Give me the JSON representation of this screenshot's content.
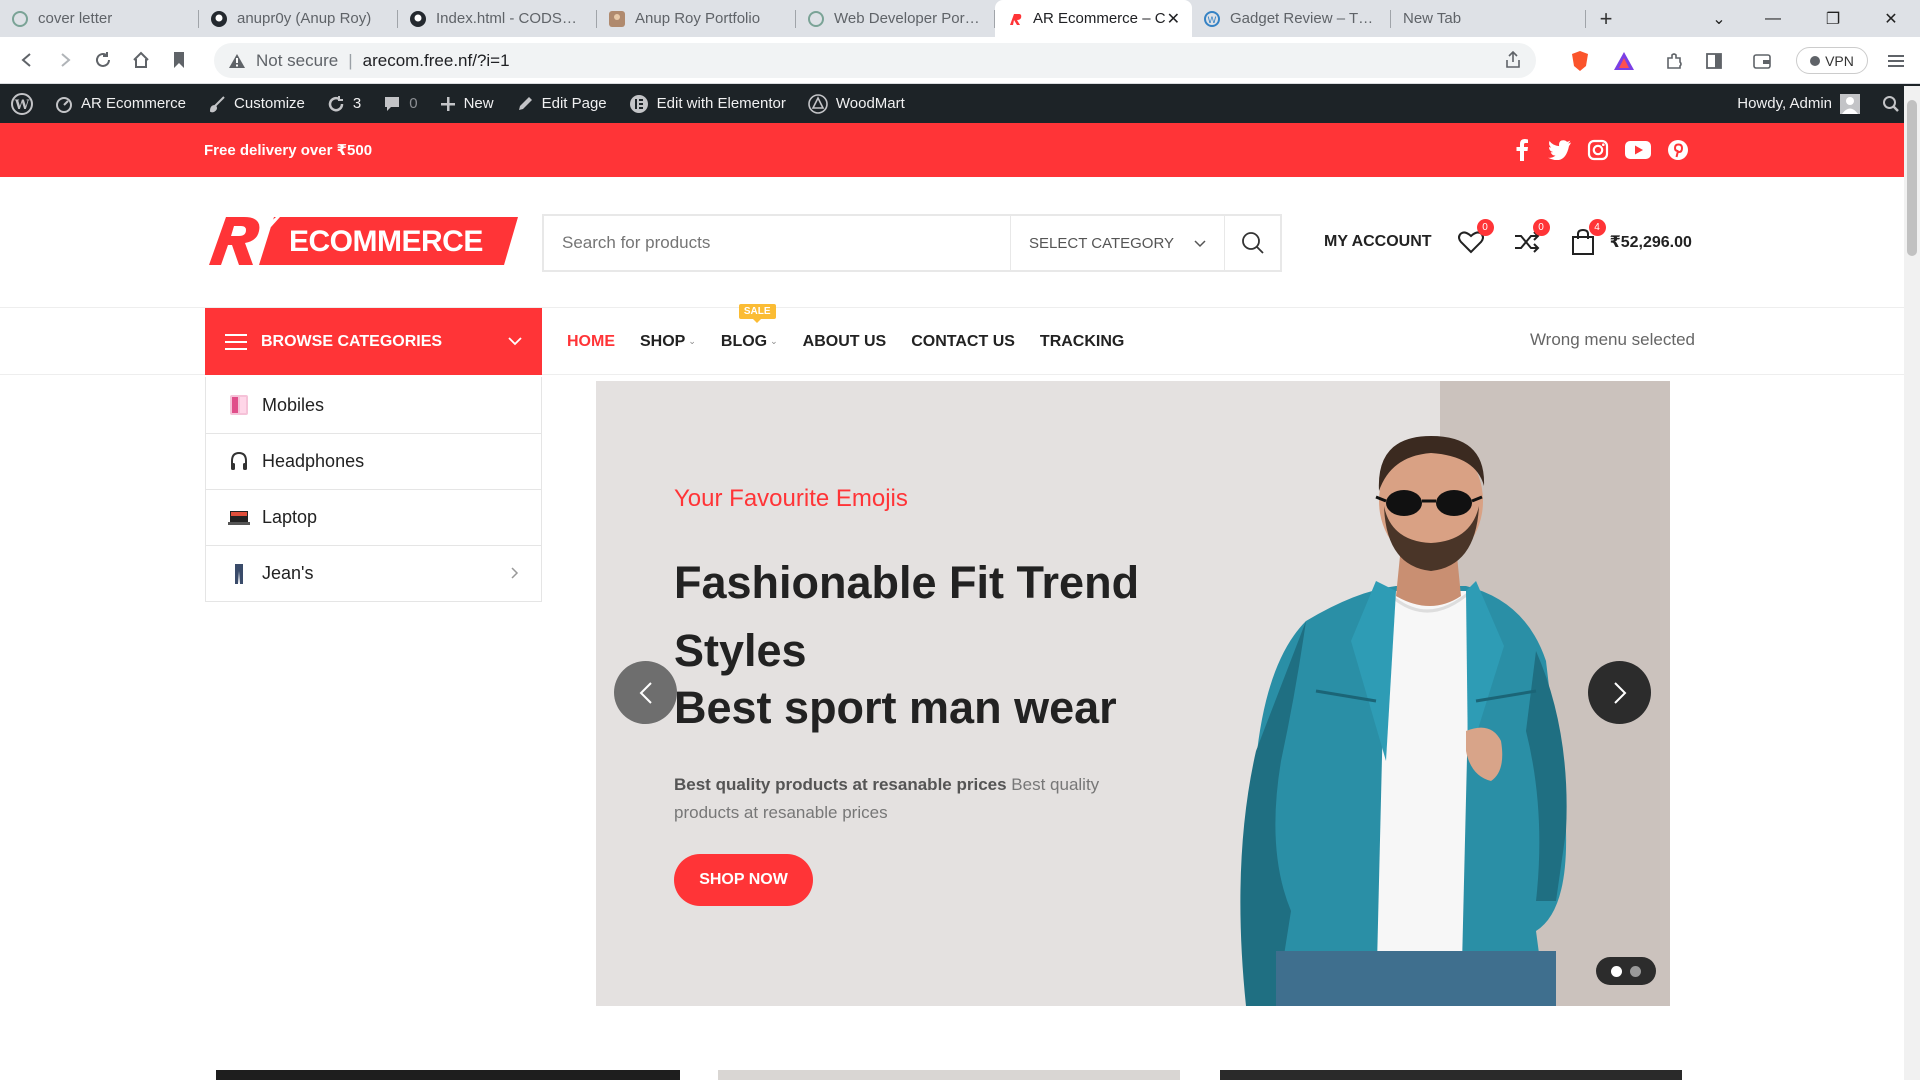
{
  "browser": {
    "tabs": [
      {
        "title": "cover letter"
      },
      {
        "title": "anupr0y (Anup Roy)"
      },
      {
        "title": "Index.html - CODSOFT"
      },
      {
        "title": "Anup Roy Portfolio"
      },
      {
        "title": "Web Developer Portfoli"
      },
      {
        "title": "AR Ecommerce – C",
        "active": true
      },
      {
        "title": "Gadget Review – The e"
      },
      {
        "title": "New Tab"
      }
    ],
    "address": {
      "security": "Not secure",
      "url": "arecom.free.nf/?i=1"
    },
    "vpn_label": "VPN"
  },
  "wp_admin_bar": {
    "site_name": "AR Ecommerce",
    "customize": "Customize",
    "updates_count": "3",
    "comments_count": "0",
    "new": "New",
    "edit_page": "Edit Page",
    "elementor": "Edit with Elementor",
    "woodmart": "WoodMart",
    "howdy": "Howdy, Admin"
  },
  "topbar": {
    "promo": "Free delivery over ₹500",
    "social": [
      "facebook-icon",
      "twitter-icon",
      "instagram-icon",
      "youtube-icon",
      "pinterest-icon"
    ]
  },
  "header": {
    "logo_text": "ECOMMERCE",
    "search_placeholder": "Search for products",
    "category_select": "SELECT CATEGORY",
    "my_account": "MY ACCOUNT",
    "wishlist_count": "0",
    "compare_count": "0",
    "cart_count": "4",
    "cart_total": "₹52,296.00"
  },
  "nav": {
    "browse": "BROWSE CATEGORIES",
    "links": [
      {
        "label": "HOME",
        "active": true
      },
      {
        "label": "SHOP"
      },
      {
        "label": "BLOG",
        "badge": "SALE"
      },
      {
        "label": "ABOUT US"
      },
      {
        "label": "CONTACT US"
      },
      {
        "label": "TRACKING"
      }
    ],
    "right_text": "Wrong menu selected"
  },
  "categories": [
    {
      "label": "Mobiles"
    },
    {
      "label": "Headphones"
    },
    {
      "label": "Laptop"
    },
    {
      "label": "Jean's"
    }
  ],
  "hero": {
    "kicker": "Your Favourite Emojis",
    "title_line1": "Fashionable Fit Trend Styles",
    "title_line2": "Best sport man wear",
    "desc_bold": "Best quality products at resanable prices",
    "desc_rest": "Best quality products at resanable prices",
    "cta": "SHOP NOW"
  },
  "colors": {
    "brand_red": "#ff3437",
    "admin_bar": "#1d2327",
    "sale_badge": "#fbbc34"
  }
}
